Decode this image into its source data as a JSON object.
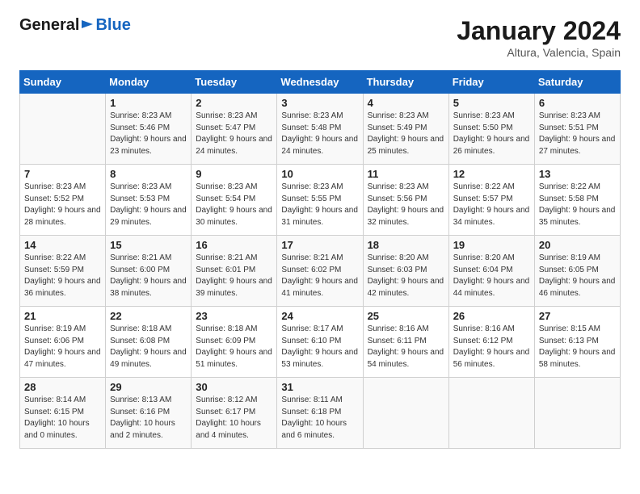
{
  "header": {
    "logo_general": "General",
    "logo_blue": "Blue",
    "month": "January 2024",
    "location": "Altura, Valencia, Spain"
  },
  "weekdays": [
    "Sunday",
    "Monday",
    "Tuesday",
    "Wednesday",
    "Thursday",
    "Friday",
    "Saturday"
  ],
  "weeks": [
    [
      {
        "day": "",
        "sunrise": "",
        "sunset": "",
        "daylight": ""
      },
      {
        "day": "1",
        "sunrise": "Sunrise: 8:23 AM",
        "sunset": "Sunset: 5:46 PM",
        "daylight": "Daylight: 9 hours and 23 minutes."
      },
      {
        "day": "2",
        "sunrise": "Sunrise: 8:23 AM",
        "sunset": "Sunset: 5:47 PM",
        "daylight": "Daylight: 9 hours and 24 minutes."
      },
      {
        "day": "3",
        "sunrise": "Sunrise: 8:23 AM",
        "sunset": "Sunset: 5:48 PM",
        "daylight": "Daylight: 9 hours and 24 minutes."
      },
      {
        "day": "4",
        "sunrise": "Sunrise: 8:23 AM",
        "sunset": "Sunset: 5:49 PM",
        "daylight": "Daylight: 9 hours and 25 minutes."
      },
      {
        "day": "5",
        "sunrise": "Sunrise: 8:23 AM",
        "sunset": "Sunset: 5:50 PM",
        "daylight": "Daylight: 9 hours and 26 minutes."
      },
      {
        "day": "6",
        "sunrise": "Sunrise: 8:23 AM",
        "sunset": "Sunset: 5:51 PM",
        "daylight": "Daylight: 9 hours and 27 minutes."
      }
    ],
    [
      {
        "day": "7",
        "sunrise": "Sunrise: 8:23 AM",
        "sunset": "Sunset: 5:52 PM",
        "daylight": "Daylight: 9 hours and 28 minutes."
      },
      {
        "day": "8",
        "sunrise": "Sunrise: 8:23 AM",
        "sunset": "Sunset: 5:53 PM",
        "daylight": "Daylight: 9 hours and 29 minutes."
      },
      {
        "day": "9",
        "sunrise": "Sunrise: 8:23 AM",
        "sunset": "Sunset: 5:54 PM",
        "daylight": "Daylight: 9 hours and 30 minutes."
      },
      {
        "day": "10",
        "sunrise": "Sunrise: 8:23 AM",
        "sunset": "Sunset: 5:55 PM",
        "daylight": "Daylight: 9 hours and 31 minutes."
      },
      {
        "day": "11",
        "sunrise": "Sunrise: 8:23 AM",
        "sunset": "Sunset: 5:56 PM",
        "daylight": "Daylight: 9 hours and 32 minutes."
      },
      {
        "day": "12",
        "sunrise": "Sunrise: 8:22 AM",
        "sunset": "Sunset: 5:57 PM",
        "daylight": "Daylight: 9 hours and 34 minutes."
      },
      {
        "day": "13",
        "sunrise": "Sunrise: 8:22 AM",
        "sunset": "Sunset: 5:58 PM",
        "daylight": "Daylight: 9 hours and 35 minutes."
      }
    ],
    [
      {
        "day": "14",
        "sunrise": "Sunrise: 8:22 AM",
        "sunset": "Sunset: 5:59 PM",
        "daylight": "Daylight: 9 hours and 36 minutes."
      },
      {
        "day": "15",
        "sunrise": "Sunrise: 8:21 AM",
        "sunset": "Sunset: 6:00 PM",
        "daylight": "Daylight: 9 hours and 38 minutes."
      },
      {
        "day": "16",
        "sunrise": "Sunrise: 8:21 AM",
        "sunset": "Sunset: 6:01 PM",
        "daylight": "Daylight: 9 hours and 39 minutes."
      },
      {
        "day": "17",
        "sunrise": "Sunrise: 8:21 AM",
        "sunset": "Sunset: 6:02 PM",
        "daylight": "Daylight: 9 hours and 41 minutes."
      },
      {
        "day": "18",
        "sunrise": "Sunrise: 8:20 AM",
        "sunset": "Sunset: 6:03 PM",
        "daylight": "Daylight: 9 hours and 42 minutes."
      },
      {
        "day": "19",
        "sunrise": "Sunrise: 8:20 AM",
        "sunset": "Sunset: 6:04 PM",
        "daylight": "Daylight: 9 hours and 44 minutes."
      },
      {
        "day": "20",
        "sunrise": "Sunrise: 8:19 AM",
        "sunset": "Sunset: 6:05 PM",
        "daylight": "Daylight: 9 hours and 46 minutes."
      }
    ],
    [
      {
        "day": "21",
        "sunrise": "Sunrise: 8:19 AM",
        "sunset": "Sunset: 6:06 PM",
        "daylight": "Daylight: 9 hours and 47 minutes."
      },
      {
        "day": "22",
        "sunrise": "Sunrise: 8:18 AM",
        "sunset": "Sunset: 6:08 PM",
        "daylight": "Daylight: 9 hours and 49 minutes."
      },
      {
        "day": "23",
        "sunrise": "Sunrise: 8:18 AM",
        "sunset": "Sunset: 6:09 PM",
        "daylight": "Daylight: 9 hours and 51 minutes."
      },
      {
        "day": "24",
        "sunrise": "Sunrise: 8:17 AM",
        "sunset": "Sunset: 6:10 PM",
        "daylight": "Daylight: 9 hours and 53 minutes."
      },
      {
        "day": "25",
        "sunrise": "Sunrise: 8:16 AM",
        "sunset": "Sunset: 6:11 PM",
        "daylight": "Daylight: 9 hours and 54 minutes."
      },
      {
        "day": "26",
        "sunrise": "Sunrise: 8:16 AM",
        "sunset": "Sunset: 6:12 PM",
        "daylight": "Daylight: 9 hours and 56 minutes."
      },
      {
        "day": "27",
        "sunrise": "Sunrise: 8:15 AM",
        "sunset": "Sunset: 6:13 PM",
        "daylight": "Daylight: 9 hours and 58 minutes."
      }
    ],
    [
      {
        "day": "28",
        "sunrise": "Sunrise: 8:14 AM",
        "sunset": "Sunset: 6:15 PM",
        "daylight": "Daylight: 10 hours and 0 minutes."
      },
      {
        "day": "29",
        "sunrise": "Sunrise: 8:13 AM",
        "sunset": "Sunset: 6:16 PM",
        "daylight": "Daylight: 10 hours and 2 minutes."
      },
      {
        "day": "30",
        "sunrise": "Sunrise: 8:12 AM",
        "sunset": "Sunset: 6:17 PM",
        "daylight": "Daylight: 10 hours and 4 minutes."
      },
      {
        "day": "31",
        "sunrise": "Sunrise: 8:11 AM",
        "sunset": "Sunset: 6:18 PM",
        "daylight": "Daylight: 10 hours and 6 minutes."
      },
      {
        "day": "",
        "sunrise": "",
        "sunset": "",
        "daylight": ""
      },
      {
        "day": "",
        "sunrise": "",
        "sunset": "",
        "daylight": ""
      },
      {
        "day": "",
        "sunrise": "",
        "sunset": "",
        "daylight": ""
      }
    ]
  ]
}
